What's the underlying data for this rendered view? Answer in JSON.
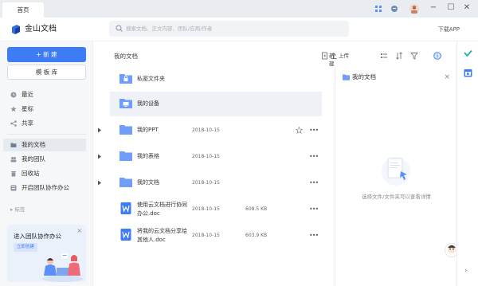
{
  "titlebar": {
    "tab_label": "首页"
  },
  "header": {
    "app_name": "金山文档",
    "search_placeholder": "搜索文档、正文内容、团队/应用/作者",
    "download_label": "下载APP"
  },
  "sidebar": {
    "new_label": "+ 新 建",
    "template_label": "模 板 库",
    "items": [
      {
        "label": "最近",
        "icon": "clock-icon"
      },
      {
        "label": "星标",
        "icon": "star-icon"
      },
      {
        "label": "共享",
        "icon": "share-icon"
      },
      {
        "label": "我的文档",
        "icon": "folder-icon"
      },
      {
        "label": "我的团队",
        "icon": "team-icon"
      },
      {
        "label": "回收站",
        "icon": "trash-icon"
      },
      {
        "label": "开启团队协作办公",
        "icon": "team-collab-icon"
      }
    ],
    "tags_label": "▸ 标签",
    "promo": {
      "title": "进入团队协作办公",
      "button": "立即创建"
    }
  },
  "main": {
    "title": "我的文档",
    "toolbar": {
      "new_label": "新建",
      "upload_label": "上传"
    },
    "rows": [
      {
        "name": "私密文件夹",
        "date": "",
        "size": "",
        "type": "lock-folder"
      },
      {
        "name": "我的设备",
        "date": "",
        "size": "",
        "type": "device-folder"
      },
      {
        "name": "我的PPT",
        "date": "2018-10-15",
        "size": "",
        "type": "folder"
      },
      {
        "name": "我的表格",
        "date": "2018-10-15",
        "size": "",
        "type": "folder"
      },
      {
        "name": "我的文档",
        "date": "2018-10-15",
        "size": "",
        "type": "folder"
      },
      {
        "name": "使用云文档进行协同\n办公.doc",
        "date": "2018-10-15",
        "size": "608.5 KB",
        "type": "doc"
      },
      {
        "name": "将我的云文档分享给\n其他人.doc",
        "date": "2018-10-15",
        "size": "603.9 KB",
        "type": "doc"
      }
    ]
  },
  "detail": {
    "title": "我的文档",
    "empty_text": "选择文件/文件夹可以查看详情"
  },
  "colors": {
    "accent": "#3e7cf5",
    "folder": "#6f9df7",
    "doc": "#3e7cf5"
  }
}
